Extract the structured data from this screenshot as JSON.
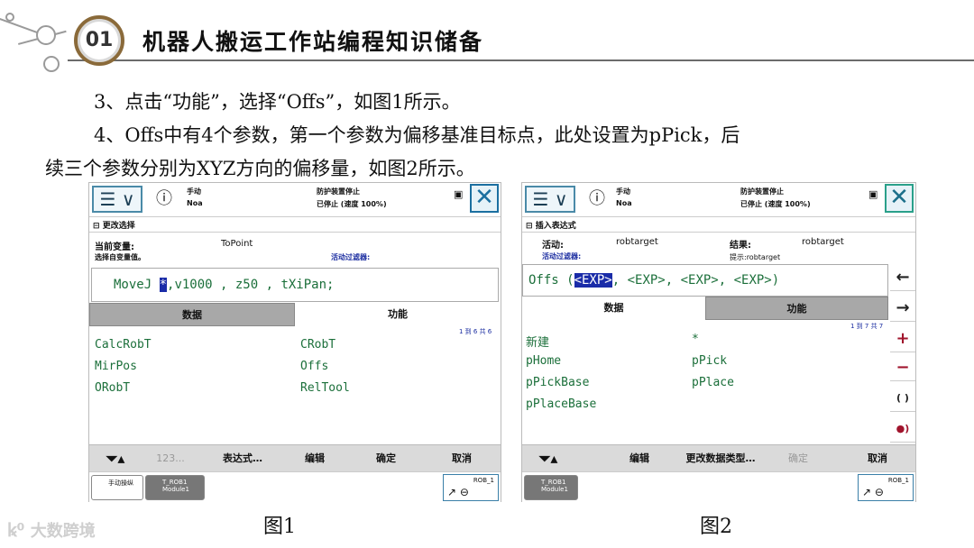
{
  "header": {
    "number": "01",
    "title": "机器人搬运工作站编程知识储备"
  },
  "content": {
    "line1": "3、点击“功能”，选择“Offs”，如图1所示。",
    "line2": "4、Offs中有4个参数，第一个参数为偏移基准目标点，此处设置为pPick，后",
    "line3": "续三个参数分别为XYZ方向的偏移量，如图2所示。"
  },
  "fig1": {
    "status_mode": "手动",
    "status_id": "Noa",
    "status_safety": "防护装置停止",
    "status_speed": "已停止 (速度 100%)",
    "breadcrumb": "更改选择",
    "current_var_label": "当前变量:",
    "current_var_value": "ToPoint",
    "select_label": "选择自变量值。",
    "filter_label": "活动过滤器:",
    "expression": "MoveJ ",
    "expression_selected": "*",
    "expression_rest": ",v1000 , z50 , tXiPan;",
    "tab_data": "数据",
    "tab_function": "功能",
    "count": "1 到 6 共 6",
    "items": [
      "CalcRobT",
      "CRobT",
      "MirPos",
      "Offs",
      "ORobT",
      "RelTool"
    ],
    "bottom": [
      "123...",
      "表达式…",
      "编辑",
      "确定",
      "取消"
    ],
    "task1": "手动操纵",
    "task2_line1": "T_ROB1",
    "task2_line2": "Module1",
    "rob": "ROB_1",
    "caption": "图1"
  },
  "fig2": {
    "status_mode": "手动",
    "status_id": "Noa",
    "status_safety": "防护装置停止",
    "status_speed": "已停止 (速度 100%)",
    "breadcrumb": "插入表达式",
    "active_label": "活动:",
    "active_value": "robtarget",
    "result_label": "结果:",
    "result_value": "robtarget",
    "filter_label": "活动过滤器:",
    "hint": "提示:robtarget",
    "expression_prefix": "Offs (",
    "expression_selected": "<EXP>",
    "expression_rest": ", <EXP>, <EXP>, <EXP>)",
    "tab_data": "数据",
    "tab_function": "功能",
    "count": "1 到 7 共 7",
    "items": [
      "新建",
      "*",
      "pHome",
      "pPick",
      "pPickBase",
      "pPlace",
      "pPlaceBase"
    ],
    "side_buttons": [
      "←",
      "→",
      "+",
      "−",
      "( )",
      "●)"
    ],
    "bottom": [
      "编辑",
      "更改数据类型…",
      "确定",
      "取消"
    ],
    "task1_line1": "T_ROB1",
    "task1_line2": "Module1",
    "rob": "ROB_1",
    "caption": "图2"
  },
  "logo": "大数跨境",
  "colors": {
    "accent": "#1b6f3a",
    "selection": "#1a2ca8",
    "tab_inactive": "#a8a8a8",
    "badge_ring": "#8a6a3a"
  }
}
